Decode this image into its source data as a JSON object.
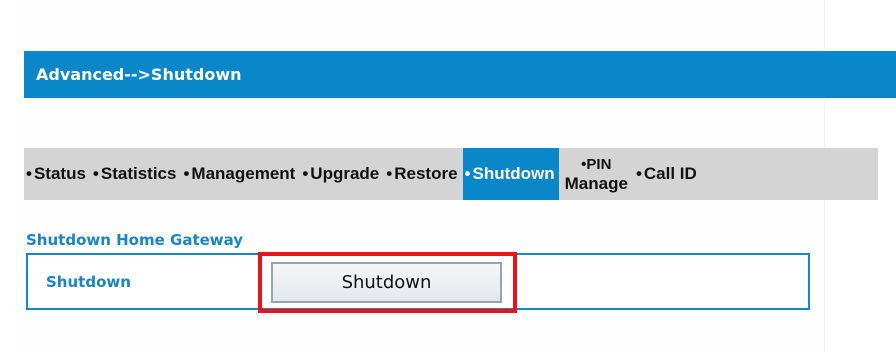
{
  "header": {
    "title": "Advanced-->Shutdown"
  },
  "nav": {
    "bullet": "•",
    "items": [
      {
        "label": "Status"
      },
      {
        "label": "Statistics"
      },
      {
        "label": "Management"
      },
      {
        "label": "Upgrade"
      },
      {
        "label": "Restore"
      },
      {
        "label": "Shutdown",
        "active": true
      },
      {
        "label_line1": "PIN",
        "label_line2": "Manage"
      },
      {
        "label": "Call ID"
      }
    ]
  },
  "section": {
    "title": "Shutdown Home Gateway",
    "row_label": "Shutdown",
    "button_label": "Shutdown"
  },
  "colors": {
    "accent": "#0a87c8",
    "highlight": "#e8141c",
    "nav_bg": "#d4d4d4"
  }
}
